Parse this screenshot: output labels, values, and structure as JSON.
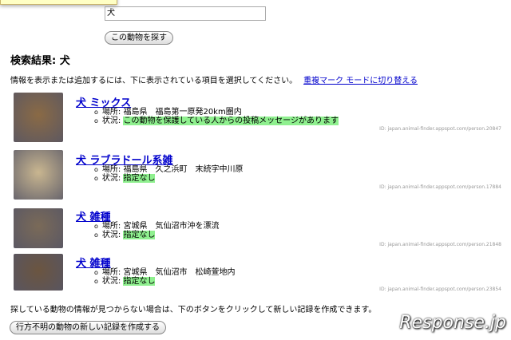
{
  "search": {
    "value": "犬",
    "button": "この動物を探す"
  },
  "heading": "検索結果: 犬",
  "instruction": "情報を表示または追加するには、下に表示されている項目を選択してください。",
  "dup_link": "重複マーク モードに切り替える",
  "results": [
    {
      "title": "犬 ミックス",
      "location": "場所: 福島県　福島第一原発20km圏内",
      "status_label": "状況: ",
      "status": "この動物を保護している人からの投稿メッセージがあります",
      "id": "ID: japan.animal-finder.appspot.com/person.20847",
      "color": "#8a6a45"
    },
    {
      "title": "犬 ラブラドール系雑",
      "location": "場所: 福島県　久之浜町　末続字中川原",
      "status_label": "状況: ",
      "status": "指定なし",
      "id": "ID: japan.animal-finder.appspot.com/person.17884",
      "color": "#c9b690"
    },
    {
      "title": "犬 雑種",
      "location": "場所: 宮城県　気仙沼市沖を漂流",
      "status_label": "状況: ",
      "status": "指定なし",
      "id": "ID: japan.animal-finder.appspot.com/person.21848",
      "color": "#7a6a58"
    },
    {
      "title": "犬 雑種",
      "location": "場所: 宮城県　気仙沼市　松崎萱地内",
      "status_label": "状況: ",
      "status": "指定なし",
      "id": "ID: japan.animal-finder.appspot.com/person.23854",
      "color": "#6b5540"
    }
  ],
  "footer": {
    "text": "探している動物の情報が見つからない場合は、下のボタンをクリックして新しい記録を作成できます。",
    "button": "行方不明の動物の新しい記録を作成する"
  },
  "watermark": "Response.jp"
}
